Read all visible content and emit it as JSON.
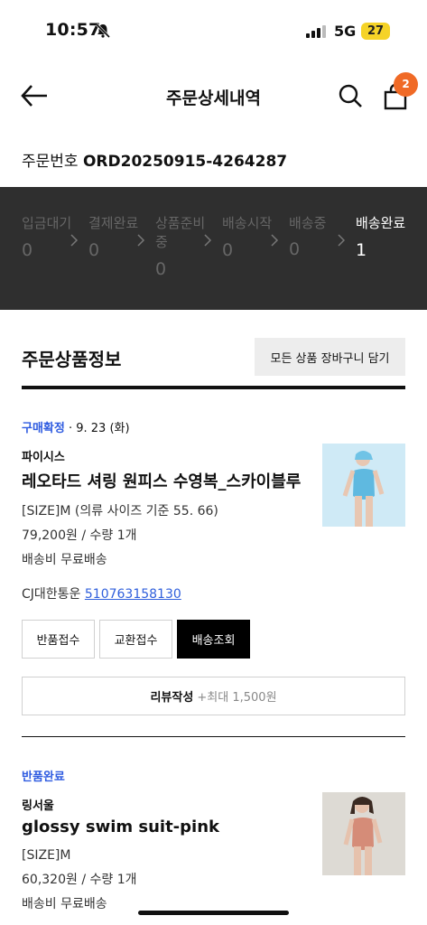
{
  "status_bar": {
    "time": "10:57",
    "network": "5G",
    "battery": "27"
  },
  "header": {
    "title": "주문상세내역",
    "cart_count": "2"
  },
  "order": {
    "label": "주문번호",
    "number": "ORD20250915-4264287"
  },
  "steps": [
    {
      "label": "입금대기",
      "count": "0"
    },
    {
      "label": "결제완료",
      "count": "0"
    },
    {
      "label": "상품준비중",
      "count": "0"
    },
    {
      "label": "배송시작",
      "count": "0"
    },
    {
      "label": "배송중",
      "count": "0"
    },
    {
      "label": "배송완료",
      "count": "1"
    }
  ],
  "section": {
    "title": "주문상품정보",
    "cart_all_button": "모든 상품 장바구니 담기"
  },
  "items": [
    {
      "status": "구매확정",
      "date": " · 9. 23 (화)",
      "brand": "파이시스",
      "name": "레오타드 셔링 원피스 수영복_스카이블루",
      "option": "[SIZE]M (의류 사이즈 기준 55. 66)",
      "price_qty": "79,200원 / 수량 1개",
      "shipping": "배송비 무료배송",
      "carrier": "CJ대한통운 ",
      "tracking_no": "510763158130",
      "thumb_color": "#8fd0ea"
    },
    {
      "status": "반품완료",
      "brand": "링서울",
      "name": "glossy swim suit-pink",
      "option": "[SIZE]M",
      "price_qty": "60,320원 / 수량 1개",
      "shipping": "배송비 무료배송",
      "thumb_color": "#d9917f"
    }
  ],
  "actions": {
    "return": "반품접수",
    "exchange": "교환접수",
    "track": "배송조회"
  },
  "review": {
    "label": "리뷰작성",
    "reward": " +최대 1,500원"
  }
}
